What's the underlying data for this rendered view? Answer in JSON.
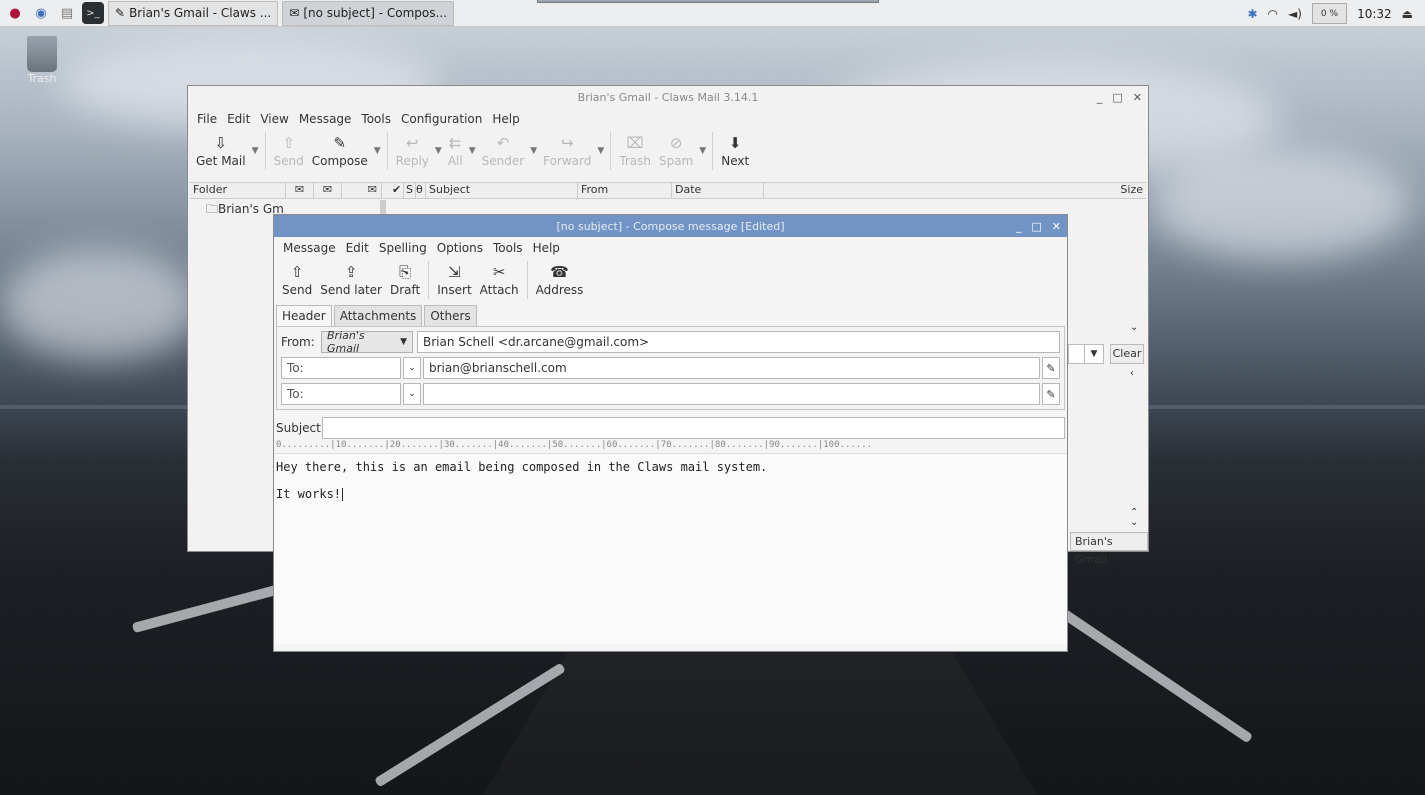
{
  "taskbar": {
    "tasks": [
      "Brian's Gmail - Claws ...",
      "[no subject] - Compos..."
    ],
    "clock": "10:32",
    "tray_box": "0 %"
  },
  "desktop": {
    "trash_label": "Trash"
  },
  "main_window": {
    "title": "Brian's Gmail - Claws Mail 3.14.1",
    "menu": [
      "File",
      "Edit",
      "View",
      "Message",
      "Tools",
      "Configuration",
      "Help"
    ],
    "toolbar": {
      "get_mail": "Get Mail",
      "send": "Send",
      "compose": "Compose",
      "reply": "Reply",
      "all": "All",
      "sender": "Sender",
      "forward": "Forward",
      "trash": "Trash",
      "spam": "Spam",
      "next": "Next"
    },
    "folder_header": "Folder",
    "folder_item": "Brian's Gm",
    "columns": {
      "s": "S",
      "subject": "Subject",
      "from": "From",
      "date": "Date",
      "size": "Size"
    },
    "search_clear": "Clear",
    "status_account": "Brian's Gmail"
  },
  "compose_window": {
    "title": "[no subject] - Compose message [Edited]",
    "menu": [
      "Message",
      "Edit",
      "Spelling",
      "Options",
      "Tools",
      "Help"
    ],
    "toolbar": {
      "send": "Send",
      "send_later": "Send later",
      "draft": "Draft",
      "insert": "Insert",
      "attach": "Attach",
      "address": "Address"
    },
    "tabs": [
      "Header",
      "Attachments",
      "Others"
    ],
    "from_label": "From:",
    "from_account": "Brian's Gmail",
    "from_value": "Brian Schell <dr.arcane@gmail.com>",
    "to_rows": [
      {
        "type": "To:",
        "value": "brian@brianschell.com"
      },
      {
        "type": "To:",
        "value": ""
      }
    ],
    "subject_label": "Subject:",
    "subject_value": "",
    "ruler": "0.........|10.......|20.......|30.......|40.......|50.......|60.......|70.......|80.......|90.......|100......",
    "body_line1": "Hey there, this is an email being composed in the Claws mail system.",
    "body_line2": "It works!"
  }
}
